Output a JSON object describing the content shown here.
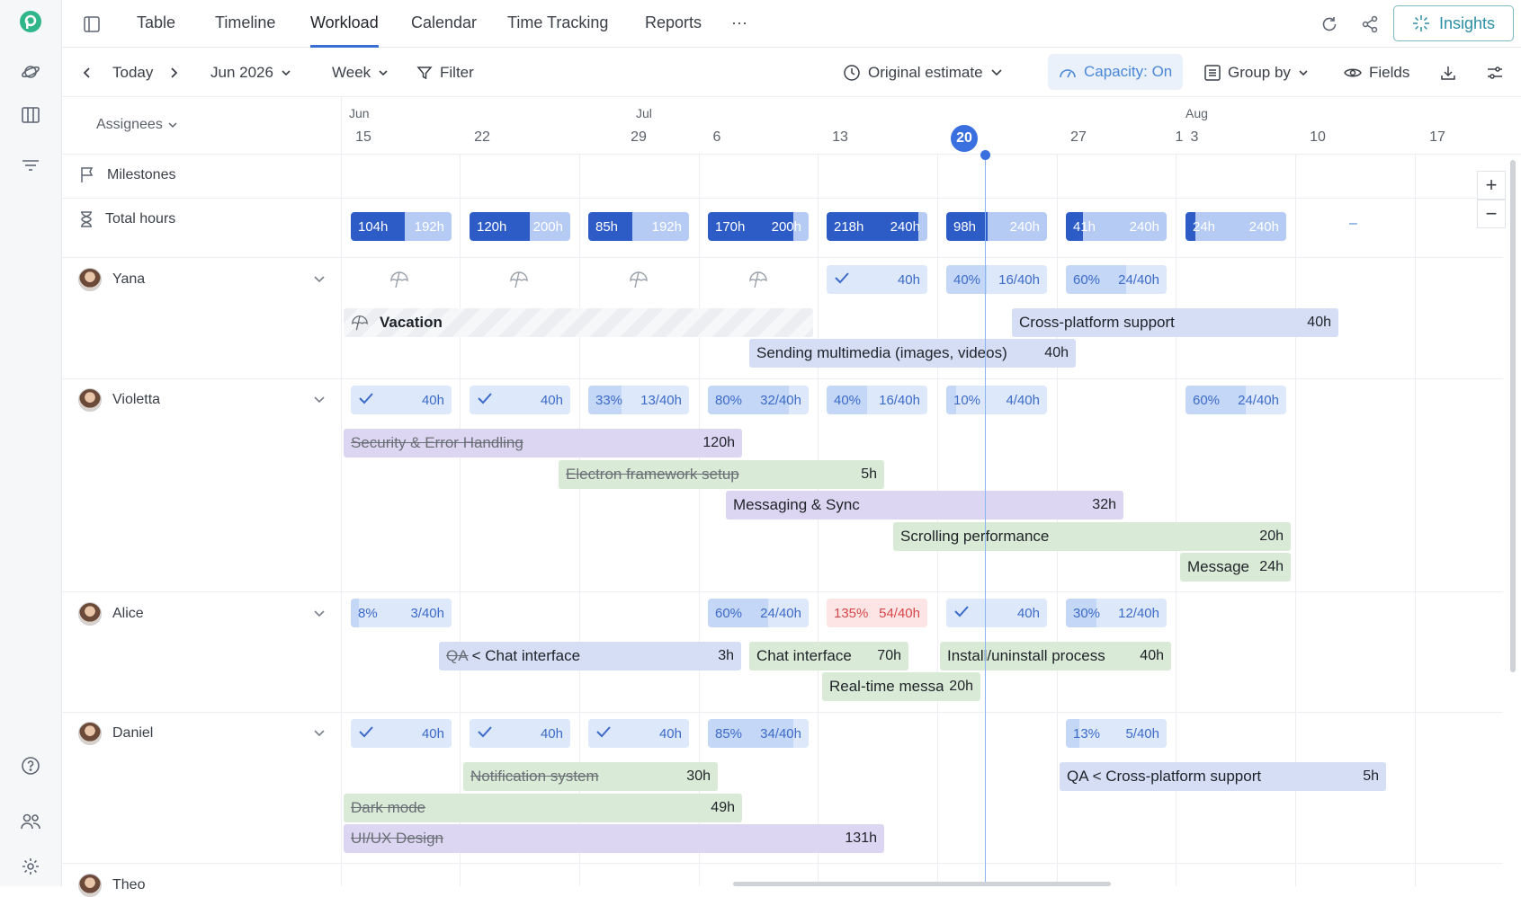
{
  "nav": {
    "tabs": [
      "Table",
      "Timeline",
      "Workload",
      "Calendar",
      "Time Tracking",
      "Reports"
    ],
    "more": "···",
    "active": "Workload",
    "insights_label": "Insights"
  },
  "toolbar": {
    "today": "Today",
    "month": "Jun 2026",
    "view": "Week",
    "filter": "Filter",
    "estimate": "Original estimate",
    "capacity": "Capacity: On",
    "group_by": "Group by",
    "fields": "Fields"
  },
  "header": {
    "assignees": "Assignees",
    "months": [
      "Jun",
      "Jul",
      "Aug"
    ],
    "days": [
      "15",
      "22",
      "29",
      "6",
      "13",
      "20",
      "27",
      "1",
      "3",
      "10",
      "17"
    ],
    "today": "20"
  },
  "rows": {
    "milestones": "Milestones",
    "total_hours": "Total hours",
    "total_caps": [
      {
        "a": "104h",
        "b": "192h",
        "f": 0.54
      },
      {
        "a": "120h",
        "b": "200h",
        "f": 0.6
      },
      {
        "a": "85h",
        "b": "192h",
        "f": 0.44
      },
      {
        "a": "170h",
        "b": "200h",
        "f": 0.85
      },
      {
        "a": "218h",
        "b": "240h",
        "f": 0.91
      },
      {
        "a": "98h",
        "b": "240h",
        "f": 0.41
      },
      {
        "a": "41h",
        "b": "240h",
        "f": 0.17
      },
      {
        "a": "24h",
        "b": "240h",
        "f": 0.1
      }
    ],
    "total_dash": "–"
  },
  "people": {
    "yana": {
      "name": "Yana",
      "caps": [
        {
          "l": "",
          "r": "40h",
          "check": true
        },
        {
          "l": "40%",
          "r": "16/40h",
          "f": 0.4
        },
        {
          "l": "60%",
          "r": "24/40h",
          "f": 0.6
        }
      ],
      "tasks": {
        "vacation": {
          "name": "Vacation"
        },
        "cross": {
          "name": "Cross-platform support",
          "hours": "40h"
        },
        "multimedia": {
          "name": "Sending multimedia (images, videos)",
          "hours": "40h"
        }
      }
    },
    "violetta": {
      "name": "Violetta",
      "caps": [
        {
          "l": "",
          "r": "40h",
          "check": true
        },
        {
          "l": "",
          "r": "40h",
          "check": true
        },
        {
          "l": "33%",
          "r": "13/40h",
          "f": 0.33
        },
        {
          "l": "80%",
          "r": "32/40h",
          "f": 0.8
        },
        {
          "l": "40%",
          "r": "16/40h",
          "f": 0.4
        },
        {
          "l": "10%",
          "r": "4/40h",
          "f": 0.1
        },
        {
          "l": "60%",
          "r": "24/40h",
          "f": 0.6
        }
      ],
      "tasks": {
        "security": {
          "name": "Security & Error Handling",
          "hours": "120h"
        },
        "electron": {
          "name": "Electron framework setup",
          "hours": "5h"
        },
        "messaging": {
          "name": "Messaging & Sync",
          "hours": "32h"
        },
        "scrolling": {
          "name": "Scrolling performance",
          "hours": "20h"
        },
        "message": {
          "name": "Message",
          "hours": "24h"
        }
      }
    },
    "alice": {
      "name": "Alice",
      "caps": [
        {
          "l": "8%",
          "r": "3/40h",
          "f": 0.08
        },
        {
          "l": "60%",
          "r": "24/40h",
          "f": 0.6
        },
        {
          "l": "135%",
          "r": "54/40h",
          "f": 1
        },
        {
          "l": "",
          "r": "40h",
          "check": true
        },
        {
          "l": "30%",
          "r": "12/40h",
          "f": 0.3
        }
      ],
      "tasks": {
        "qa_chat_prefix": "QA",
        "qa_chat": {
          "name": "< Chat interface",
          "hours": "3h"
        },
        "chat": {
          "name": "Chat interface",
          "hours": "70h"
        },
        "install": {
          "name": "Install/uninstall process",
          "hours": "40h"
        },
        "realtime": {
          "name": "Real-time messa",
          "hours": "20h"
        }
      }
    },
    "daniel": {
      "name": "Daniel",
      "caps": [
        {
          "l": "",
          "r": "40h",
          "check": true
        },
        {
          "l": "",
          "r": "40h",
          "check": true
        },
        {
          "l": "",
          "r": "40h",
          "check": true
        },
        {
          "l": "85%",
          "r": "34/40h",
          "f": 0.85
        },
        {
          "l": "13%",
          "r": "5/40h",
          "f": 0.13
        }
      ],
      "tasks": {
        "notification": {
          "name": "Notification system",
          "hours": "30h"
        },
        "dark": {
          "name": "Dark mode",
          "hours": "49h"
        },
        "uiux": {
          "name": "UI/UX Design",
          "hours": "131h"
        },
        "qa_cross_prefix": "QA",
        "qa_cross": {
          "name": "< Cross-platform support",
          "hours": "5h"
        }
      }
    },
    "theo": {
      "name": "Theo"
    }
  },
  "zoom": {
    "plus": "+",
    "minus": "−"
  },
  "colors": {
    "accent": "#3b6fd8",
    "capacity_bar": "#2e5cc7",
    "overload": "#d8474b",
    "insights": "#2a8fa3"
  }
}
